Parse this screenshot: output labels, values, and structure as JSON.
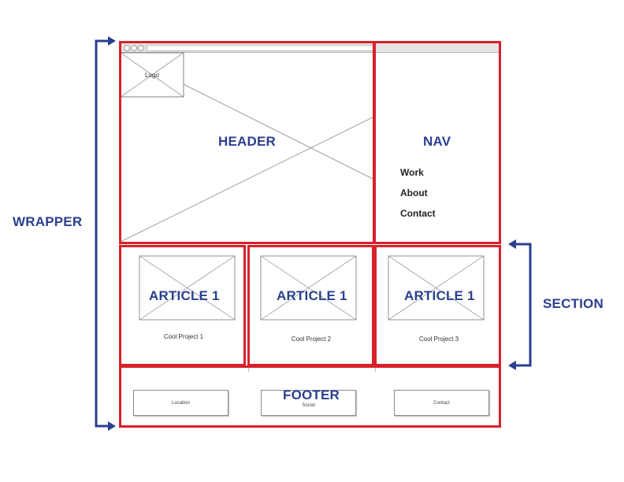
{
  "labels": {
    "wrapper": "WRAPPER",
    "section": "SECTION",
    "header": "HEADER",
    "nav": "NAV",
    "footer": "FOOTER"
  },
  "header": {
    "logo_text": "Logo"
  },
  "nav": {
    "links": [
      "Work",
      "About",
      "Contact"
    ]
  },
  "articles": [
    {
      "label": "ARTICLE 1",
      "caption": "Cool Project 1"
    },
    {
      "label": "ARTICLE 1",
      "caption": "Cool Project 2"
    },
    {
      "label": "ARTICLE 1",
      "caption": "Cool Project 3"
    }
  ],
  "footer": {
    "buttons": [
      "Location",
      "Social",
      "Contact"
    ]
  },
  "colors": {
    "region_outline": "#d8202a",
    "label": "#2a3f8f",
    "wireframe_line": "#9a9a9a"
  }
}
